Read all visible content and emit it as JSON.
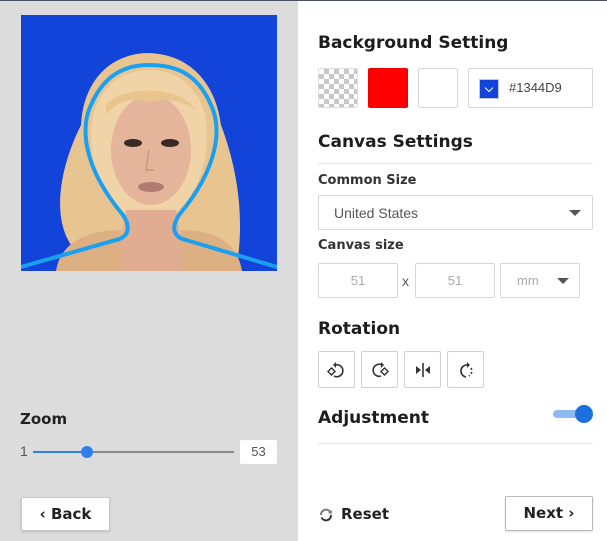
{
  "preview": {
    "background_color": "#1344D9",
    "guide_color": "#1aa0f0",
    "image_alt": "Portrait photo of a woman with long blonde hair on blue background with head-shape guide outline"
  },
  "zoom": {
    "label": "Zoom",
    "min_label": "1",
    "value": "53",
    "fraction": 0.27
  },
  "buttons": {
    "back": "‹ Back",
    "reset": "Reset",
    "next": "Next ›"
  },
  "background_setting": {
    "title": "Background Setting",
    "swatches": [
      {
        "name": "transparent"
      },
      {
        "name": "red",
        "color": "#FE0000"
      },
      {
        "name": "white",
        "color": "#FFFFFF"
      }
    ],
    "custom_color": "#1344D9"
  },
  "canvas_settings": {
    "title": "Canvas Settings",
    "common_size_label": "Common Size",
    "common_size_value": "United States",
    "canvas_size_label": "Canvas size",
    "width": "51",
    "separator": "x",
    "height": "51",
    "unit": "mm"
  },
  "rotation": {
    "title": "Rotation",
    "buttons": [
      {
        "icon": "rotate-left-icon"
      },
      {
        "icon": "rotate-right-icon"
      },
      {
        "icon": "flip-horizontal-icon"
      },
      {
        "icon": "rotate-custom-icon"
      }
    ]
  },
  "adjustment": {
    "title": "Adjustment",
    "enabled": true
  }
}
